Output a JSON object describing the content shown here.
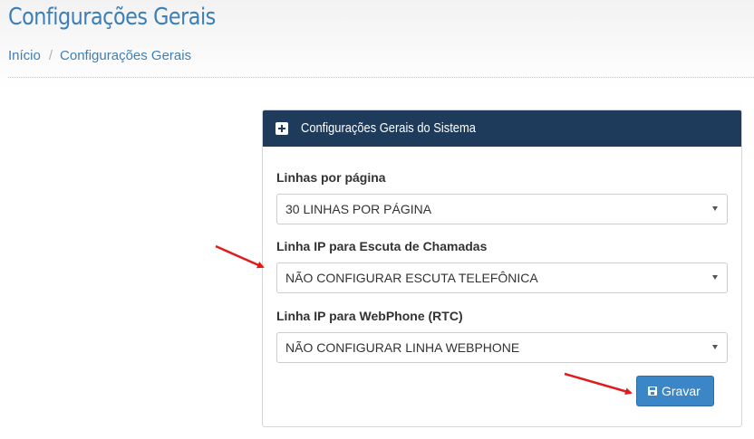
{
  "page": {
    "title": "Configurações Gerais",
    "breadcrumb": {
      "home": "Início",
      "separator": "/",
      "current": "Configurações Gerais"
    }
  },
  "panel": {
    "title": "Configurações Gerais do Sistema",
    "header_icon": "plus-square-icon",
    "fields": [
      {
        "label": "Linhas por página",
        "value": "30 LINHAS POR PÁGINA"
      },
      {
        "label": "Linha IP para Escuta de Chamadas",
        "value": "NÃO CONFIGURAR ESCUTA TELEFÔNICA"
      },
      {
        "label": "Linha IP para WebPhone (RTC)",
        "value": "NÃO CONFIGURAR LINHA WEBPHONE"
      }
    ],
    "save_button": {
      "label": "Gravar",
      "icon": "floppy-disk-icon"
    }
  },
  "colors": {
    "accent": "#3c7fb8",
    "panel_header": "#1e3b5c",
    "button": "#3b86c6",
    "annotation_arrow": "#e01b1b"
  }
}
